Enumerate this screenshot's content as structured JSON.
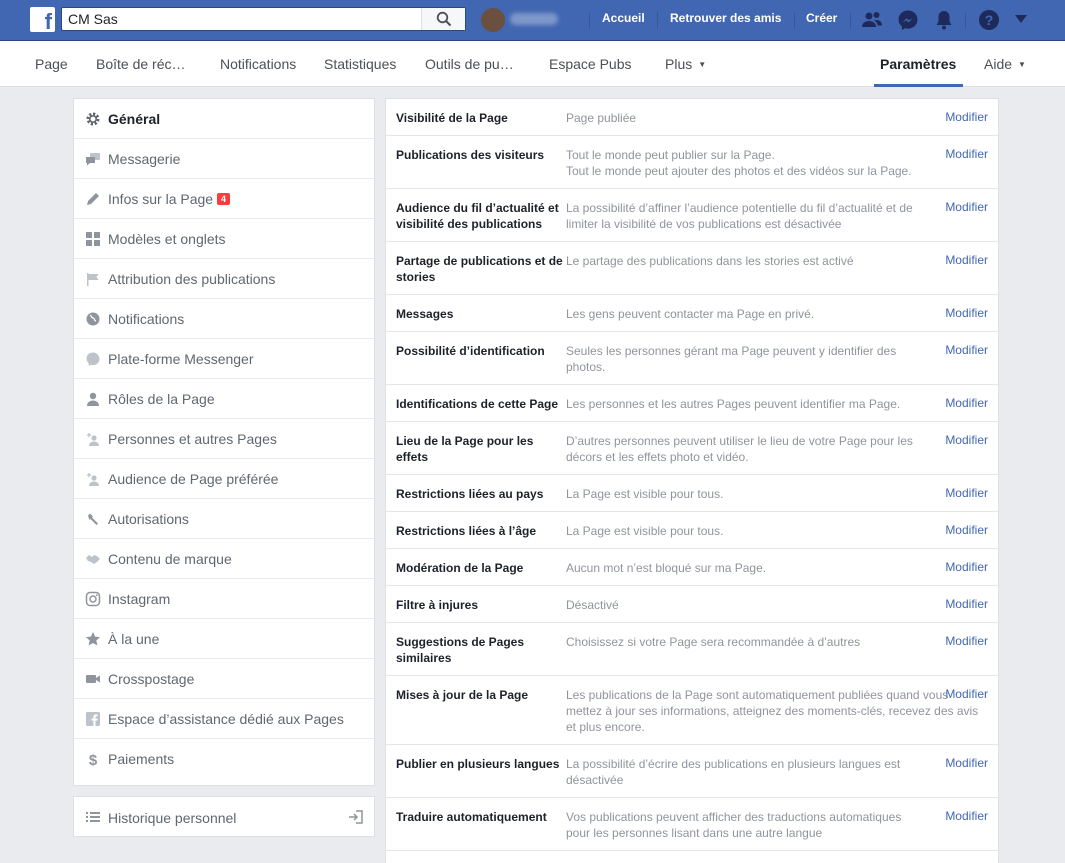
{
  "topbar": {
    "logo": "f",
    "search_value": "CM Sas",
    "links": [
      "Accueil",
      "Retrouver des amis",
      "Créer"
    ],
    "icons": [
      "friends-icon",
      "messenger-icon",
      "bell-icon",
      "help-icon",
      "caret-down-icon"
    ]
  },
  "pagenav": {
    "items": [
      "Page",
      "Boîte de réc…",
      "Notifications",
      "Statistiques",
      "Outils de pu…",
      "Espace Pubs",
      "Plus",
      "Paramètres",
      "Aide"
    ]
  },
  "sidebar": {
    "items": [
      {
        "label": "Général",
        "icon": "gear-icon"
      },
      {
        "label": "Messagerie",
        "icon": "chat-icon"
      },
      {
        "label": "Infos sur la Page",
        "icon": "pencil-icon",
        "badge": "4"
      },
      {
        "label": "Modèles et onglets",
        "icon": "grid-icon"
      },
      {
        "label": "Attribution des publications",
        "icon": "flag-icon"
      },
      {
        "label": "Notifications",
        "icon": "globe-icon"
      },
      {
        "label": "Plate-forme Messenger",
        "icon": "messenger-icon"
      },
      {
        "label": "Rôles de la Page",
        "icon": "person-icon"
      },
      {
        "label": "Personnes et autres Pages",
        "icon": "add-person-icon"
      },
      {
        "label": "Audience de Page préférée",
        "icon": "add-person-icon"
      },
      {
        "label": "Autorisations",
        "icon": "wrench-icon"
      },
      {
        "label": "Contenu de marque",
        "icon": "handshake-icon"
      },
      {
        "label": "Instagram",
        "icon": "instagram-icon"
      },
      {
        "label": "À la une",
        "icon": "star-icon"
      },
      {
        "label": "Crosspostage",
        "icon": "video-icon"
      },
      {
        "label": "Espace d’assistance dédié aux Pages",
        "icon": "facebook-icon"
      },
      {
        "label": "Paiements",
        "icon": "dollar-icon"
      }
    ],
    "history": {
      "label": "Historique personnel",
      "icon": "list-icon",
      "action_icon": "sign-in-icon"
    }
  },
  "settings": {
    "edit_label": "Modifier",
    "rows": [
      {
        "title": "Visibilité de la Page",
        "desc": "Page publiée"
      },
      {
        "title": "Publications des visiteurs",
        "desc": "Tout le monde peut publier sur la Page.\nTout le monde peut ajouter des photos et des vidéos sur la Page."
      },
      {
        "title": "Audience du fil d’actualité et visibilité des publications",
        "desc": "La possibilité d’affiner l’audience potentielle du fil d’actualité et de limiter la visibilité de vos publications est désactivée"
      },
      {
        "title": "Partage de publications et de stories",
        "desc": "Le partage des publications dans les stories est activé"
      },
      {
        "title": "Messages",
        "desc": "Les gens peuvent contacter ma Page en privé."
      },
      {
        "title": "Possibilité d’identification",
        "desc": "Seules les personnes gérant ma Page peuvent y identifier des photos."
      },
      {
        "title": "Identifications de cette Page",
        "desc": "Les personnes et les autres Pages peuvent identifier ma Page."
      },
      {
        "title": "Lieu de la Page pour les effets",
        "desc": "D’autres personnes peuvent utiliser le lieu de votre Page pour les décors et les effets photo et vidéo."
      },
      {
        "title": "Restrictions liées au pays",
        "desc": "La Page est visible pour tous."
      },
      {
        "title": "Restrictions liées à l’âge",
        "desc": "La Page est visible pour tous."
      },
      {
        "title": "Modération de la Page",
        "desc": "Aucun mot n’est bloqué sur ma Page."
      },
      {
        "title": "Filtre à injures",
        "desc": "Désactivé"
      },
      {
        "title": "Suggestions de Pages similaires",
        "desc": "Choisissez si votre Page sera recommandée à d’autres"
      },
      {
        "title": "Mises à jour de la Page",
        "desc": "Les publications de la Page sont automatiquement publiées quand vous mettez à jour ses informations, atteignez des moments-clés, recevez des avis et plus encore."
      },
      {
        "title": "Publier en plusieurs langues",
        "desc": "La possibilité d’écrire des publications en plusieurs langues est désactivée"
      },
      {
        "title": "Traduire automatiquement",
        "desc": "Vos publications peuvent afficher des traductions automatiques pour les personnes lisant dans une autre langue"
      }
    ]
  }
}
